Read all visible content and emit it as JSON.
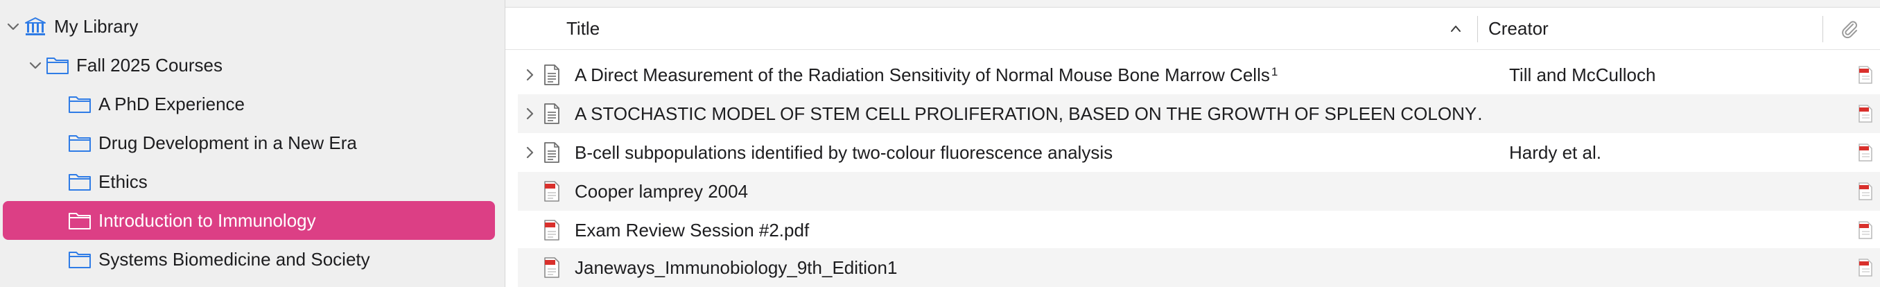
{
  "sidebar": {
    "library_label": "My Library",
    "collections": [
      {
        "label": "Fall 2025 Courses"
      },
      {
        "label": "A PhD Experience"
      },
      {
        "label": "Drug Development in a New Era"
      },
      {
        "label": "Ethics"
      },
      {
        "label": "Introduction to Immunology",
        "selected": true
      },
      {
        "label": "Systems Biomedicine and Society"
      }
    ]
  },
  "table": {
    "headers": {
      "title": "Title",
      "creator": "Creator"
    },
    "sort_indicator": "ascending",
    "rows": [
      {
        "title": "A Direct Measurement of the Radiation Sensitivity of Normal Mouse Bone Marrow Cells",
        "superscript": "1",
        "creator": "Till and McCulloch",
        "icon": "document-icon",
        "expandable": true
      },
      {
        "title": "A STOCHASTIC MODEL OF STEM CELL PROLIFERATION, BASED ON THE GROWTH OF SPLEEN COLONY…",
        "superscript": "",
        "creator": "",
        "icon": "document-icon",
        "expandable": true
      },
      {
        "title": "B-cell subpopulations identified by two-colour fluorescence analysis",
        "superscript": "",
        "creator": "Hardy et al.",
        "icon": "document-icon",
        "expandable": true
      },
      {
        "title": "Cooper lamprey 2004",
        "superscript": "",
        "creator": "",
        "icon": "pdf-icon",
        "expandable": false
      },
      {
        "title": "Exam Review Session #2.pdf",
        "superscript": "",
        "creator": "",
        "icon": "pdf-icon",
        "expandable": false
      },
      {
        "title": "Janeways_Immunobiology_9th_Edition1",
        "superscript": "",
        "creator": "",
        "icon": "pdf-icon",
        "expandable": false
      }
    ]
  },
  "colors": {
    "selection": "#dc3f85",
    "folder": "#2f7ce6",
    "pdf": "#d9302c"
  }
}
